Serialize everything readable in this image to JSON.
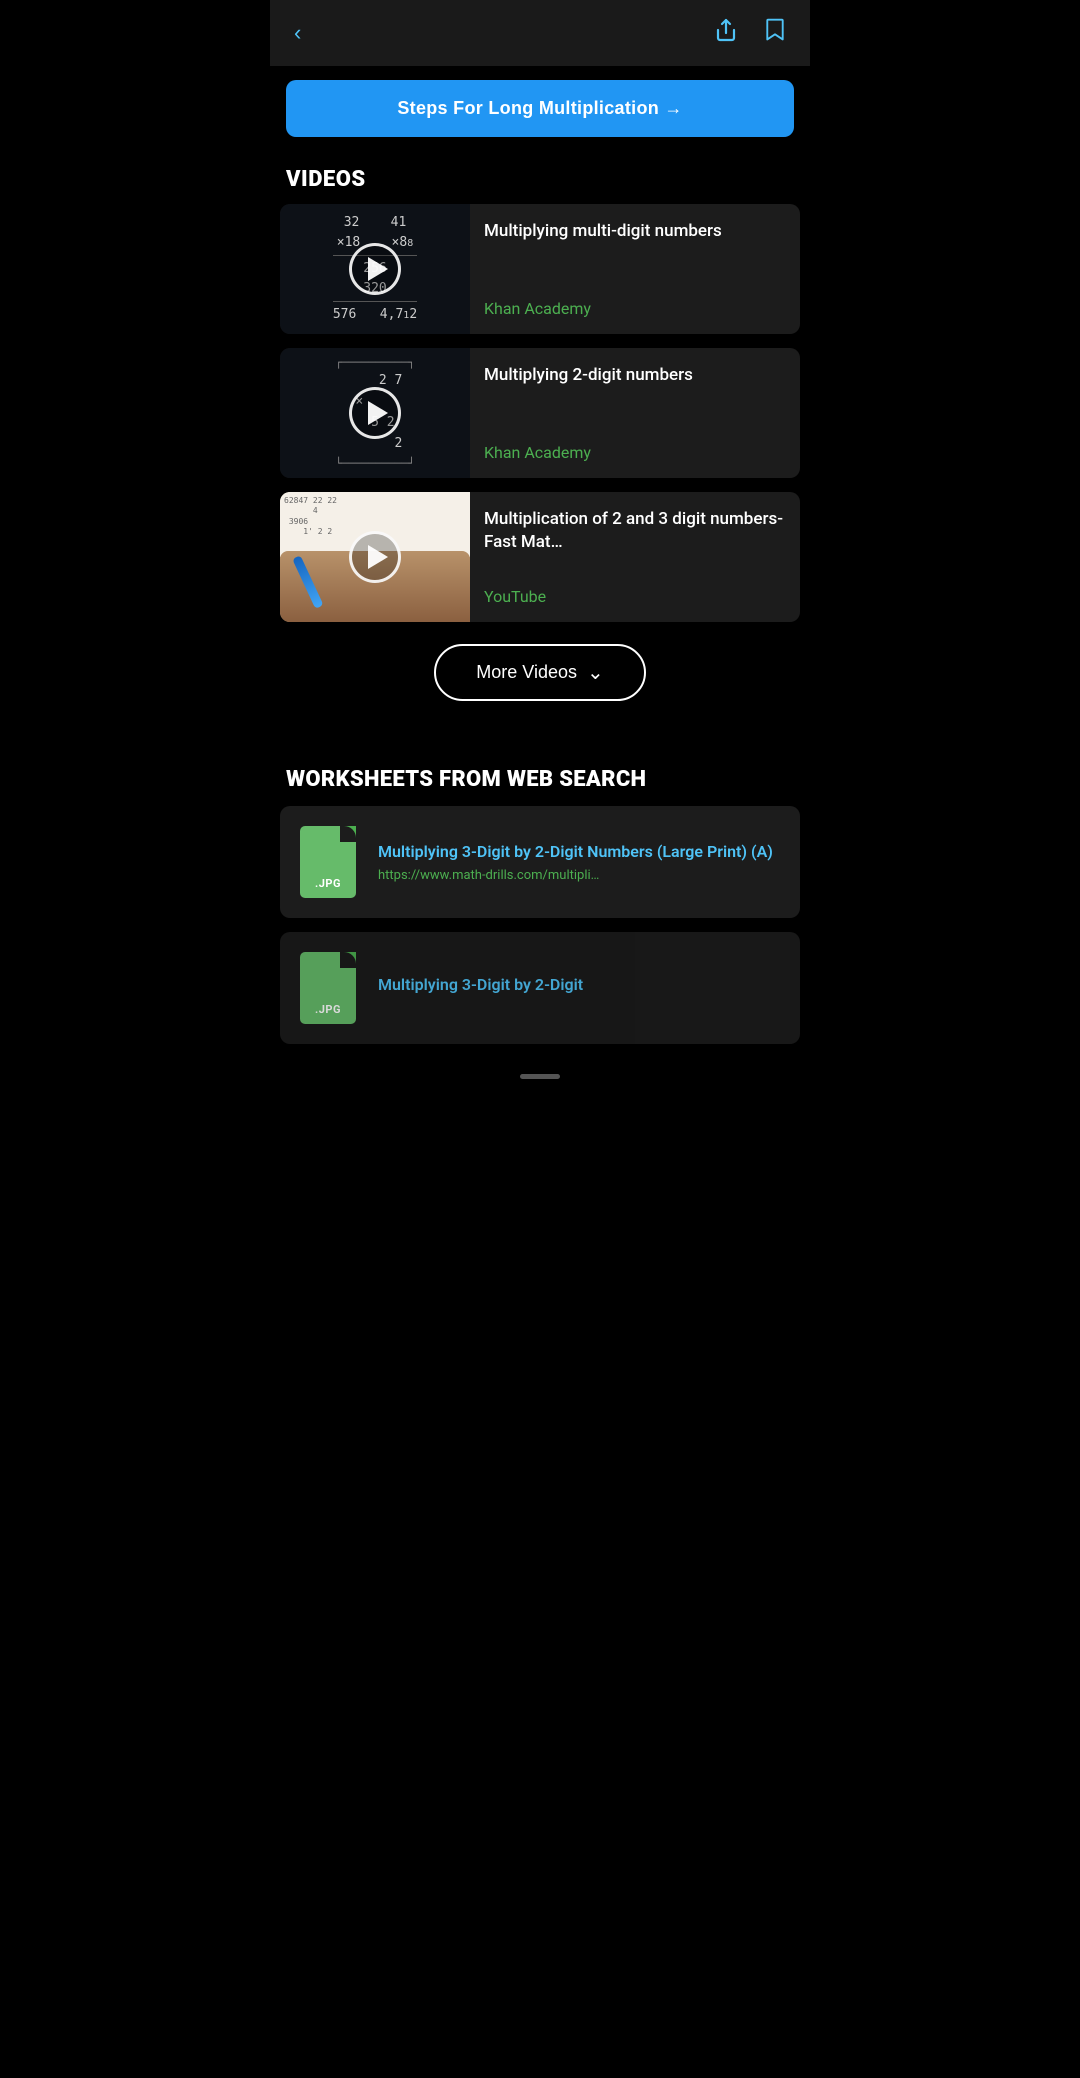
{
  "header": {
    "back_icon": "◀",
    "share_icon": "↗",
    "bookmark_icon": "🔖"
  },
  "banner": {
    "label": "Steps For Long Multiplication →"
  },
  "videos_section": {
    "title": "VIDEOS",
    "items": [
      {
        "id": 1,
        "title": "Multiplying multi-digit numbers",
        "source": "Khan Academy",
        "thumbnail_type": "math1"
      },
      {
        "id": 2,
        "title": "Multiplying 2-digit numbers",
        "source": "Khan Academy",
        "thumbnail_type": "math2"
      },
      {
        "id": 3,
        "title": "Multiplication of 2 and 3 digit numbers-Fast Mat…",
        "source": "YouTube",
        "thumbnail_type": "photo"
      }
    ],
    "more_button_label": "More Videos",
    "more_button_chevron": "∨"
  },
  "worksheets_section": {
    "title": "WORKSHEETS FROM WEB SEARCH",
    "items": [
      {
        "id": 1,
        "file_ext": ".JPG",
        "title": "Multiplying 3-Digit by 2-Digit Numbers (Large Print) (A)",
        "url": "https://www.math-drills.com/multipli…"
      },
      {
        "id": 2,
        "file_ext": ".JPG",
        "title": "Multiplying 3-Digit by 2-Digit",
        "url": ""
      }
    ]
  }
}
